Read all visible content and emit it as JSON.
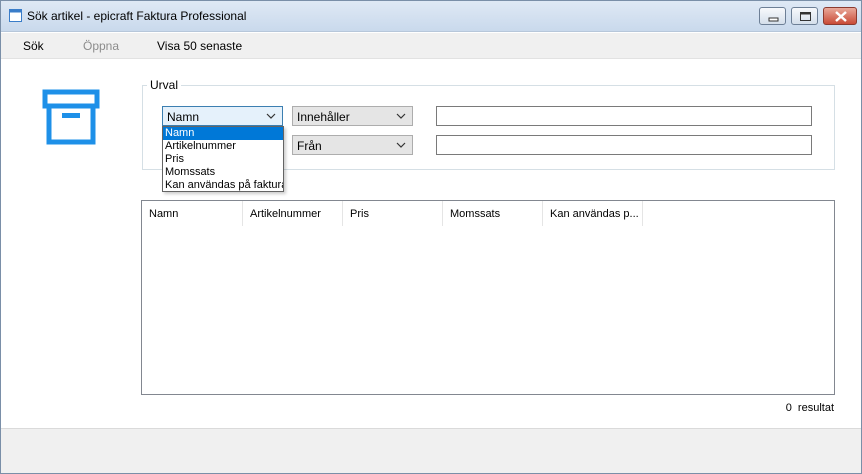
{
  "window": {
    "title": "Sök artikel - epicraft Faktura Professional"
  },
  "menu": {
    "items": [
      {
        "label": "Sök",
        "enabled": true
      },
      {
        "label": "Öppna",
        "enabled": false
      },
      {
        "label": "Visa 50 senaste",
        "enabled": true
      }
    ]
  },
  "filter": {
    "group_label": "Urval",
    "row1": {
      "field": "Namn",
      "operator": "Innehåller",
      "value": ""
    },
    "row2": {
      "operator": "Från",
      "value": ""
    },
    "dropdown_open": true,
    "dropdown_options": [
      "Namn",
      "Artikelnummer",
      "Pris",
      "Momssats",
      "Kan användas på faktura"
    ],
    "dropdown_selected": "Namn"
  },
  "results": {
    "columns": [
      "Namn",
      "Artikelnummer",
      "Pris",
      "Momssats",
      "Kan användas p..."
    ],
    "rows": [],
    "count": "0",
    "count_label": "resultat"
  },
  "icons": {
    "app": "app-window-icon",
    "box": "box-archive-icon"
  },
  "colors": {
    "accent": "#0078d7",
    "icon_blue": "#1e90e8"
  }
}
